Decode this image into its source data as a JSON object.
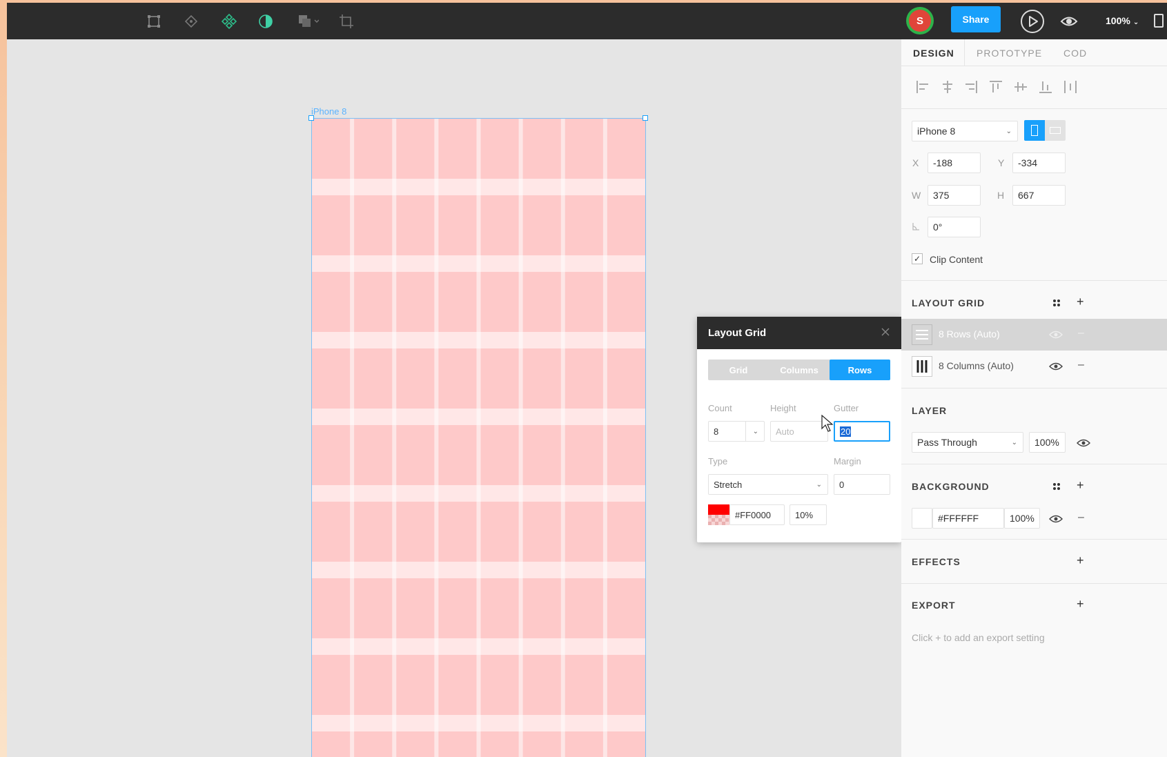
{
  "topbar": {
    "tools": [
      "frame-icon",
      "pen-icon",
      "component-icon",
      "mask-icon",
      "boolean-icon",
      "crop-icon"
    ],
    "avatar_initial": "S",
    "share_label": "Share",
    "zoom_label": "100%"
  },
  "canvas": {
    "frame_label": "iPhone 8",
    "grid": {
      "rows": 8,
      "columns": 8,
      "color": "#FF0000",
      "opacity_rows": 0.1
    }
  },
  "layout_grid_popup": {
    "title": "Layout Grid",
    "modes": [
      {
        "label": "Grid",
        "active": false
      },
      {
        "label": "Columns",
        "active": false
      },
      {
        "label": "Rows",
        "active": true
      }
    ],
    "count_label": "Count",
    "count_value": "8",
    "height_label": "Height",
    "height_value": "Auto",
    "gutter_label": "Gutter",
    "gutter_value": "20",
    "type_label": "Type",
    "type_value": "Stretch",
    "margin_label": "Margin",
    "margin_value": "0",
    "color_hex": "#FF0000",
    "color_opacity": "10%"
  },
  "panel": {
    "tabs": [
      {
        "label": "DESIGN",
        "active": true
      },
      {
        "label": "PROTOTYPE",
        "active": false
      },
      {
        "label": "COD",
        "active": false
      }
    ],
    "device": "iPhone 8",
    "x_label": "X",
    "x_value": "-188",
    "y_label": "Y",
    "y_value": "-334",
    "w_label": "W",
    "w_value": "375",
    "h_label": "H",
    "h_value": "667",
    "rotation_value": "0°",
    "clip_content_label": "Clip Content",
    "layout_grid_title": "LAYOUT GRID",
    "layout_grid_items": [
      {
        "label": "8 Rows (Auto)",
        "selected": true
      },
      {
        "label": "8 Columns (Auto)",
        "selected": false
      }
    ],
    "layer_title": "LAYER",
    "layer_mode": "Pass Through",
    "layer_opacity": "100%",
    "background_title": "BACKGROUND",
    "background_hex": "#FFFFFF",
    "background_opacity": "100%",
    "effects_title": "EFFECTS",
    "export_title": "EXPORT",
    "export_hint": "Click + to add an export setting"
  }
}
